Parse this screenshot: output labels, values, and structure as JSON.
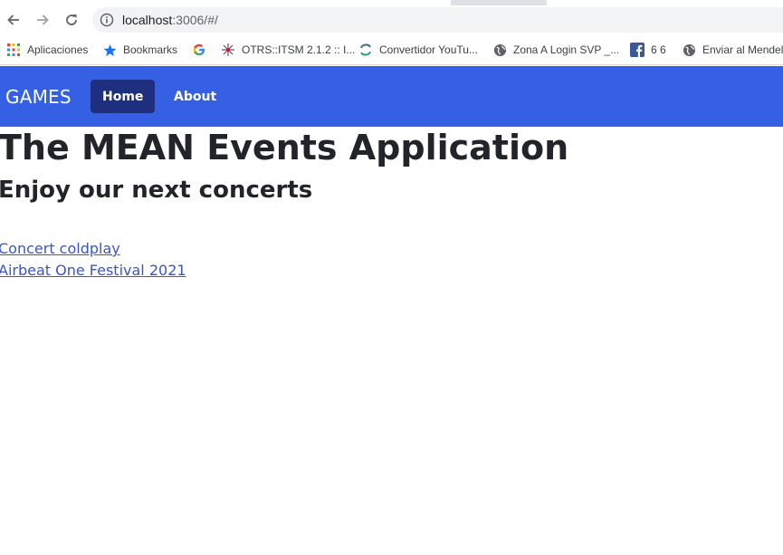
{
  "browser": {
    "url_host": "localhost",
    "url_rest": ":3006/#/",
    "bookmarks": [
      {
        "label": "Aplicaciones",
        "icon": "apps-grid-icon"
      },
      {
        "label": "Bookmarks",
        "icon": "star-icon"
      },
      {
        "label": "",
        "icon": "google-icon"
      },
      {
        "label": "OTRS::ITSM 2.1.2 :: I...",
        "icon": "otrs-icon"
      },
      {
        "label": "Convertidor YouTu...",
        "icon": "converter-icon"
      },
      {
        "label": "Zona A Login SVP _...",
        "icon": "globe-icon"
      },
      {
        "label": "6 6",
        "icon": "facebook-icon"
      },
      {
        "label": "Enviar al Mendele",
        "icon": "globe-icon"
      }
    ],
    "colors": {
      "accent": "#3660e3",
      "active_link_bg": "#1e2f80",
      "link": "#3a55c8"
    }
  },
  "navbar": {
    "brand": "GAMES",
    "links": [
      {
        "label": "Home",
        "active": true
      },
      {
        "label": "About",
        "active": false
      }
    ]
  },
  "main": {
    "title": "The MEAN Events Application",
    "subtitle": "Enjoy our next concerts",
    "events": [
      {
        "label": "Concert coldplay"
      },
      {
        "label": "Airbeat One Festival 2021"
      }
    ]
  }
}
